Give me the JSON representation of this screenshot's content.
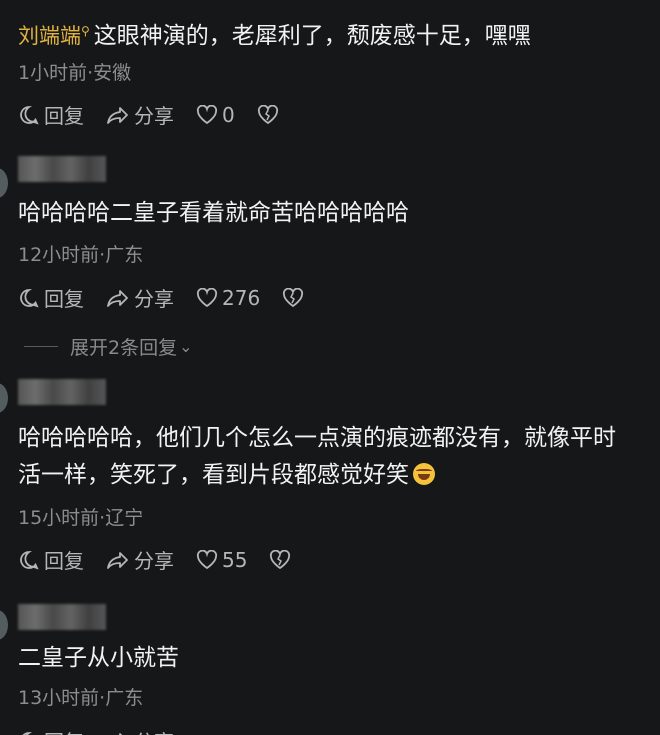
{
  "comments": [
    {
      "username": "刘端端",
      "text": "这眼神演的，老犀利了，颓废感十足，嘿嘿",
      "meta": "1小时前·安徽",
      "reply_label": "回复",
      "share_label": "分享",
      "likes": "0"
    },
    {
      "text": "哈哈哈哈二皇子看着就命苦哈哈哈哈哈",
      "meta": "12小时前·广东",
      "reply_label": "回复",
      "share_label": "分享",
      "likes": "276",
      "expand_label": "展开2条回复"
    },
    {
      "text_line1": "哈哈哈哈哈，他们几个怎么一点演的痕迹都没有，就像平时",
      "text_line2": "活一样，笑死了，看到片段都感觉好笑",
      "emoji": "laughing-tears-emoji",
      "meta": "15小时前·辽宁",
      "reply_label": "回复",
      "share_label": "分享",
      "likes": "55"
    },
    {
      "text": "二皇子从小就苦",
      "meta": "13小时前·广东",
      "reply_label": "回复",
      "share_label": "分享"
    }
  ],
  "colors": {
    "background": "#161718",
    "username_gold": "#e0b341",
    "meta_gray": "#8d8d8d"
  }
}
